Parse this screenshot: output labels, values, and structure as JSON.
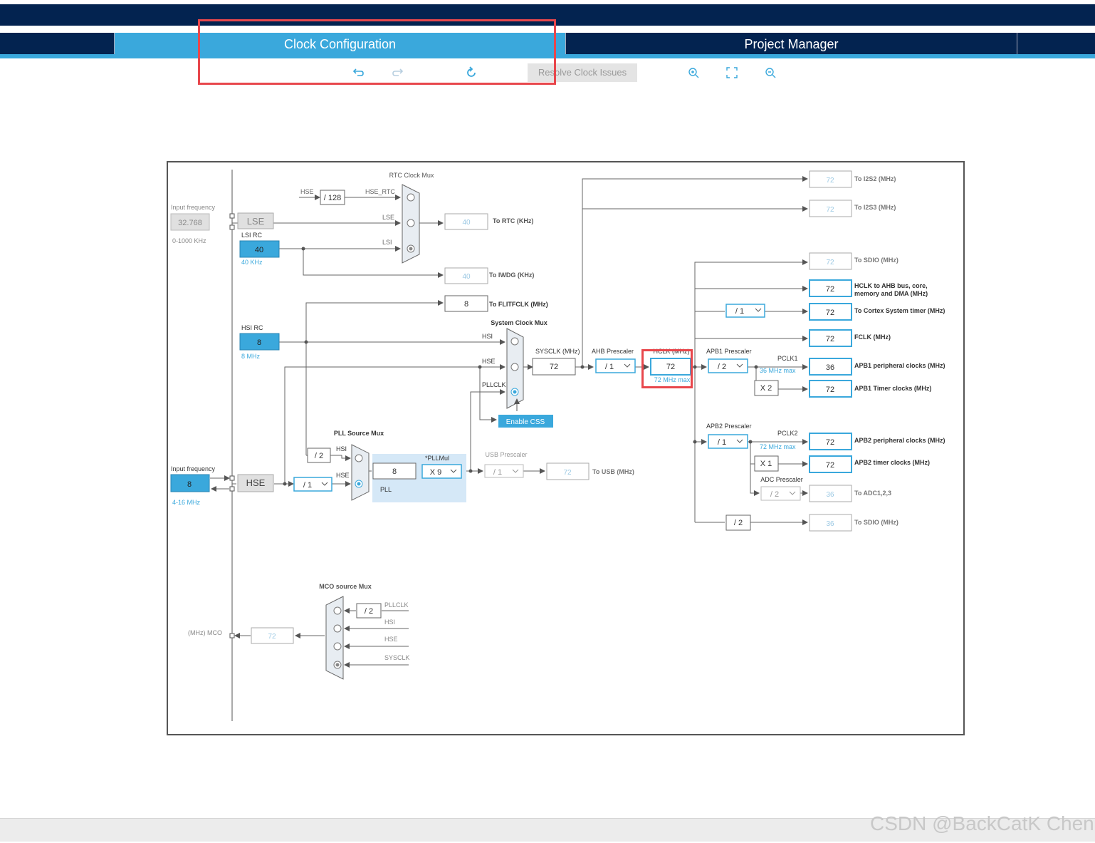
{
  "tabs": [
    {
      "label": "Clock Configuration",
      "active": true
    },
    {
      "label": "Project Manager",
      "active": false
    }
  ],
  "toolbar": {
    "undo_icon": "undo-icon",
    "redo_icon": "redo-icon",
    "refresh_icon": "refresh-icon",
    "resolve_label": "Resolve Clock Issues",
    "zoom_in_icon": "zoom-in-icon",
    "fit_icon": "fit-screen-icon",
    "zoom_out_icon": "zoom-out-icon"
  },
  "colors": {
    "navy": "#032350",
    "accent": "#3aa8dc",
    "highlight": "#e8474c"
  },
  "diagram": {
    "rtc_mux_title": "RTC Clock Mux",
    "hse_label": "HSE",
    "div128": "/ 128",
    "hse_rtc": "HSE_RTC",
    "lse_line": "LSE",
    "lsi_line": "LSI",
    "input_freq_label": "Input frequency",
    "lse_freq": "32.768",
    "lse_range": "0-1000 KHz",
    "lse_box": "LSE",
    "lsi_rc_label": "LSI RC",
    "lsi_value": "40",
    "lsi_freq": "40 KHz",
    "rtc_value": "40",
    "rtc_label": "To RTC (KHz)",
    "iwdg_value": "40",
    "iwdg_label": "To IWDG (KHz)",
    "flit_value": "8",
    "flit_label": "To FLITFCLK (MHz)",
    "hsi_rc_label": "HSI RC",
    "hsi_value": "8",
    "hsi_freq": "8 MHz",
    "sys_mux_title": "System Clock Mux",
    "hsi_in": "HSI",
    "hse_in": "HSE",
    "pllclk_in": "PLLCLK",
    "sysclk_label": "SYSCLK (MHz)",
    "sysclk_value": "72",
    "ahb_label": "AHB Prescaler",
    "ahb_value": "/ 1",
    "hclk_label": "HCLK (MHz)",
    "hclk_value": "72",
    "hclk_max": "72 MHz max",
    "enable_css": "Enable CSS",
    "pll_src_title": "PLL Source Mux",
    "pll_div2": "/ 2",
    "pll_hsi": "HSI",
    "pll_hse": "HSE",
    "hse_input_label": "Input frequency",
    "hse_input_value": "8",
    "hse_range": "4-16 MHz",
    "hse_box": "HSE",
    "hse_div": "/ 1",
    "pll_in_value": "8",
    "pllmul_label": "*PLLMul",
    "pllmul_value": "X 9",
    "pll_label": "PLL",
    "usb_label": "USB Prescaler",
    "usb_div": "/ 1",
    "usb_value": "72",
    "usb_out": "To USB (MHz)",
    "i2s2_value": "72",
    "i2s2_label": "To I2S2 (MHz)",
    "i2s3_value": "72",
    "i2s3_label": "To I2S3 (MHz)",
    "sdio1_value": "72",
    "sdio1_label": "To SDIO (MHz)",
    "hclk_ahb_value": "72",
    "hclk_ahb_label1": "HCLK to AHB bus, core,",
    "hclk_ahb_label2": "memory and DMA (MHz)",
    "cortex_div": "/ 1",
    "cortex_value": "72",
    "cortex_label": "To Cortex System timer (MHz)",
    "fclk_value": "72",
    "fclk_label": "FCLK (MHz)",
    "apb1_label": "APB1 Prescaler",
    "apb1_div": "/ 2",
    "pclk1_label": "PCLK1",
    "pclk1_max": "36 MHz max",
    "apb1_periph_value": "36",
    "apb1_periph_label": "APB1 peripheral clocks (MHz)",
    "apb1_x2": "X 2",
    "apb1_timer_value": "72",
    "apb1_timer_label": "APB1 Timer clocks (MHz)",
    "apb2_label": "APB2 Prescaler",
    "apb2_div": "/ 1",
    "pclk2_label": "PCLK2",
    "pclk2_max": "72 MHz max",
    "apb2_periph_value": "72",
    "apb2_periph_label": "APB2 peripheral clocks (MHz)",
    "apb2_x1": "X 1",
    "apb2_timer_value": "72",
    "apb2_timer_label": "APB2 timer clocks (MHz)",
    "adc_label": "ADC Prescaler",
    "adc_div": "/ 2",
    "adc_value": "36",
    "adc_out": "To ADC1,2,3",
    "sdio2_div": "/ 2",
    "sdio2_value": "36",
    "sdio2_label": "To SDIO (MHz)",
    "mco_title": "MCO source Mux",
    "mco_div2": "/ 2",
    "mco_pllclk": "PLLCLK",
    "mco_hsi": "HSI",
    "mco_hse": "HSE",
    "mco_sysclk": "SYSCLK",
    "mco_label": "(MHz) MCO",
    "mco_value": "72"
  },
  "watermark": "CSDN @BackCatK Chen"
}
